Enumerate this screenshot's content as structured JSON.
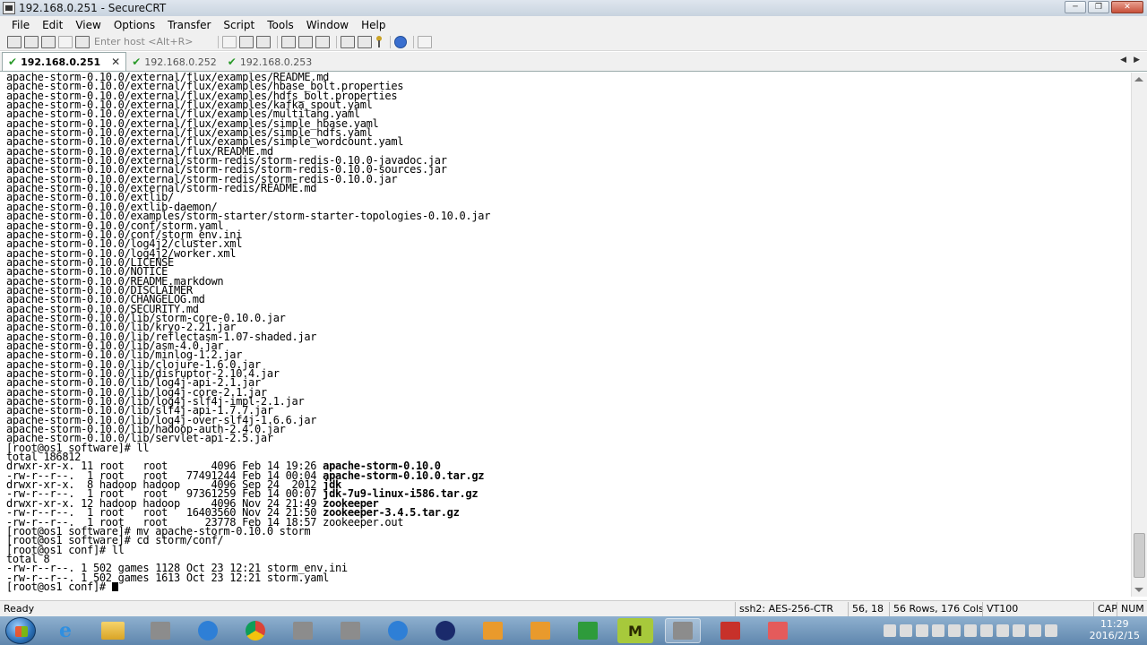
{
  "window": {
    "title": "192.168.0.251 - SecureCRT"
  },
  "menu": [
    "File",
    "Edit",
    "View",
    "Options",
    "Transfer",
    "Script",
    "Tools",
    "Window",
    "Help"
  ],
  "toolbar": {
    "host_placeholder": "Enter host <Alt+R>"
  },
  "tabs": [
    {
      "label": "192.168.0.251",
      "active": true
    },
    {
      "label": "192.168.0.252",
      "active": false
    },
    {
      "label": "192.168.0.253",
      "active": false
    }
  ],
  "terminal": {
    "lines": [
      "apache-storm-0.10.0/external/flux/examples/README.md",
      "apache-storm-0.10.0/external/flux/examples/hbase_bolt.properties",
      "apache-storm-0.10.0/external/flux/examples/hdfs_bolt.properties",
      "apache-storm-0.10.0/external/flux/examples/kafka_spout.yaml",
      "apache-storm-0.10.0/external/flux/examples/multilang.yaml",
      "apache-storm-0.10.0/external/flux/examples/simple_hbase.yaml",
      "apache-storm-0.10.0/external/flux/examples/simple_hdfs.yaml",
      "apache-storm-0.10.0/external/flux/examples/simple_wordcount.yaml",
      "apache-storm-0.10.0/external/flux/README.md",
      "apache-storm-0.10.0/external/storm-redis/storm-redis-0.10.0-javadoc.jar",
      "apache-storm-0.10.0/external/storm-redis/storm-redis-0.10.0-sources.jar",
      "apache-storm-0.10.0/external/storm-redis/storm-redis-0.10.0.jar",
      "apache-storm-0.10.0/external/storm-redis/README.md",
      "apache-storm-0.10.0/extlib/",
      "apache-storm-0.10.0/extlib-daemon/",
      "apache-storm-0.10.0/examples/storm-starter/storm-starter-topologies-0.10.0.jar",
      "apache-storm-0.10.0/conf/storm.yaml",
      "apache-storm-0.10.0/conf/storm_env.ini",
      "apache-storm-0.10.0/log4j2/cluster.xml",
      "apache-storm-0.10.0/log4j2/worker.xml",
      "apache-storm-0.10.0/LICENSE",
      "apache-storm-0.10.0/NOTICE",
      "apache-storm-0.10.0/README.markdown",
      "apache-storm-0.10.0/DISCLAIMER",
      "apache-storm-0.10.0/CHANGELOG.md",
      "apache-storm-0.10.0/SECURITY.md",
      "apache-storm-0.10.0/lib/storm-core-0.10.0.jar",
      "apache-storm-0.10.0/lib/kryo-2.21.jar",
      "apache-storm-0.10.0/lib/reflectasm-1.07-shaded.jar",
      "apache-storm-0.10.0/lib/asm-4.0.jar",
      "apache-storm-0.10.0/lib/minlog-1.2.jar",
      "apache-storm-0.10.0/lib/clojure-1.6.0.jar",
      "apache-storm-0.10.0/lib/disruptor-2.10.4.jar",
      "apache-storm-0.10.0/lib/log4j-api-2.1.jar",
      "apache-storm-0.10.0/lib/log4j-core-2.1.jar",
      "apache-storm-0.10.0/lib/log4j-slf4j-impl-2.1.jar",
      "apache-storm-0.10.0/lib/slf4j-api-1.7.7.jar",
      "apache-storm-0.10.0/lib/log4j-over-slf4j-1.6.6.jar",
      "apache-storm-0.10.0/lib/hadoop-auth-2.4.0.jar",
      "apache-storm-0.10.0/lib/servlet-api-2.5.jar",
      "[root@os1 software]# ll",
      "total 186812"
    ],
    "listing": [
      {
        "meta": "drwxr-xr-x. 11 root   root       4096 Feb 14 19:26 ",
        "name": "apache-storm-0.10.0",
        "bold": true
      },
      {
        "meta": "-rw-r--r--.  1 root   root   77491244 Feb 14 00:04 ",
        "name": "apache-storm-0.10.0.tar.gz",
        "bold": true
      },
      {
        "meta": "drwxr-xr-x.  8 hadoop hadoop     4096 Sep 24  2012 ",
        "name": "jdk",
        "bold": true
      },
      {
        "meta": "-rw-r--r--.  1 root   root   97361259 Feb 14 00:07 ",
        "name": "jdk-7u9-linux-i586.tar.gz",
        "bold": true
      },
      {
        "meta": "drwxr-xr-x. 12 hadoop hadoop     4096 Nov 24 21:49 ",
        "name": "zookeeper",
        "bold": true
      },
      {
        "meta": "-rw-r--r--.  1 root   root   16403560 Nov 24 21:50 ",
        "name": "zookeeper-3.4.5.tar.gz",
        "bold": true
      },
      {
        "meta": "-rw-r--r--.  1 root   root      23778 Feb 14 18:57 ",
        "name": "zookeeper.out",
        "bold": false
      }
    ],
    "tail": [
      "[root@os1 software]# mv apache-storm-0.10.0 storm",
      "[root@os1 software]# cd storm/conf/",
      "[root@os1 conf]# ll",
      "total 8",
      "-rw-r--r--. 1 502 games 1128 Oct 23 12:21 storm_env.ini",
      "-rw-r--r--. 1 502 games 1613 Oct 23 12:21 storm.yaml"
    ],
    "prompt": "[root@os1 conf]# "
  },
  "status": {
    "ready": "Ready",
    "cipher": "ssh2: AES-256-CTR",
    "cursor_pos": "56,  18",
    "size": "56 Rows, 176 Cols",
    "emulation": "VT100",
    "caps": "CAP",
    "num": "NUM"
  },
  "clock": {
    "time": "11:29",
    "date": "2016/2/15"
  },
  "colors": {
    "check": "#2a9a2a",
    "titlebar": "#c8d3df",
    "taskbar": "#5f86ad"
  }
}
